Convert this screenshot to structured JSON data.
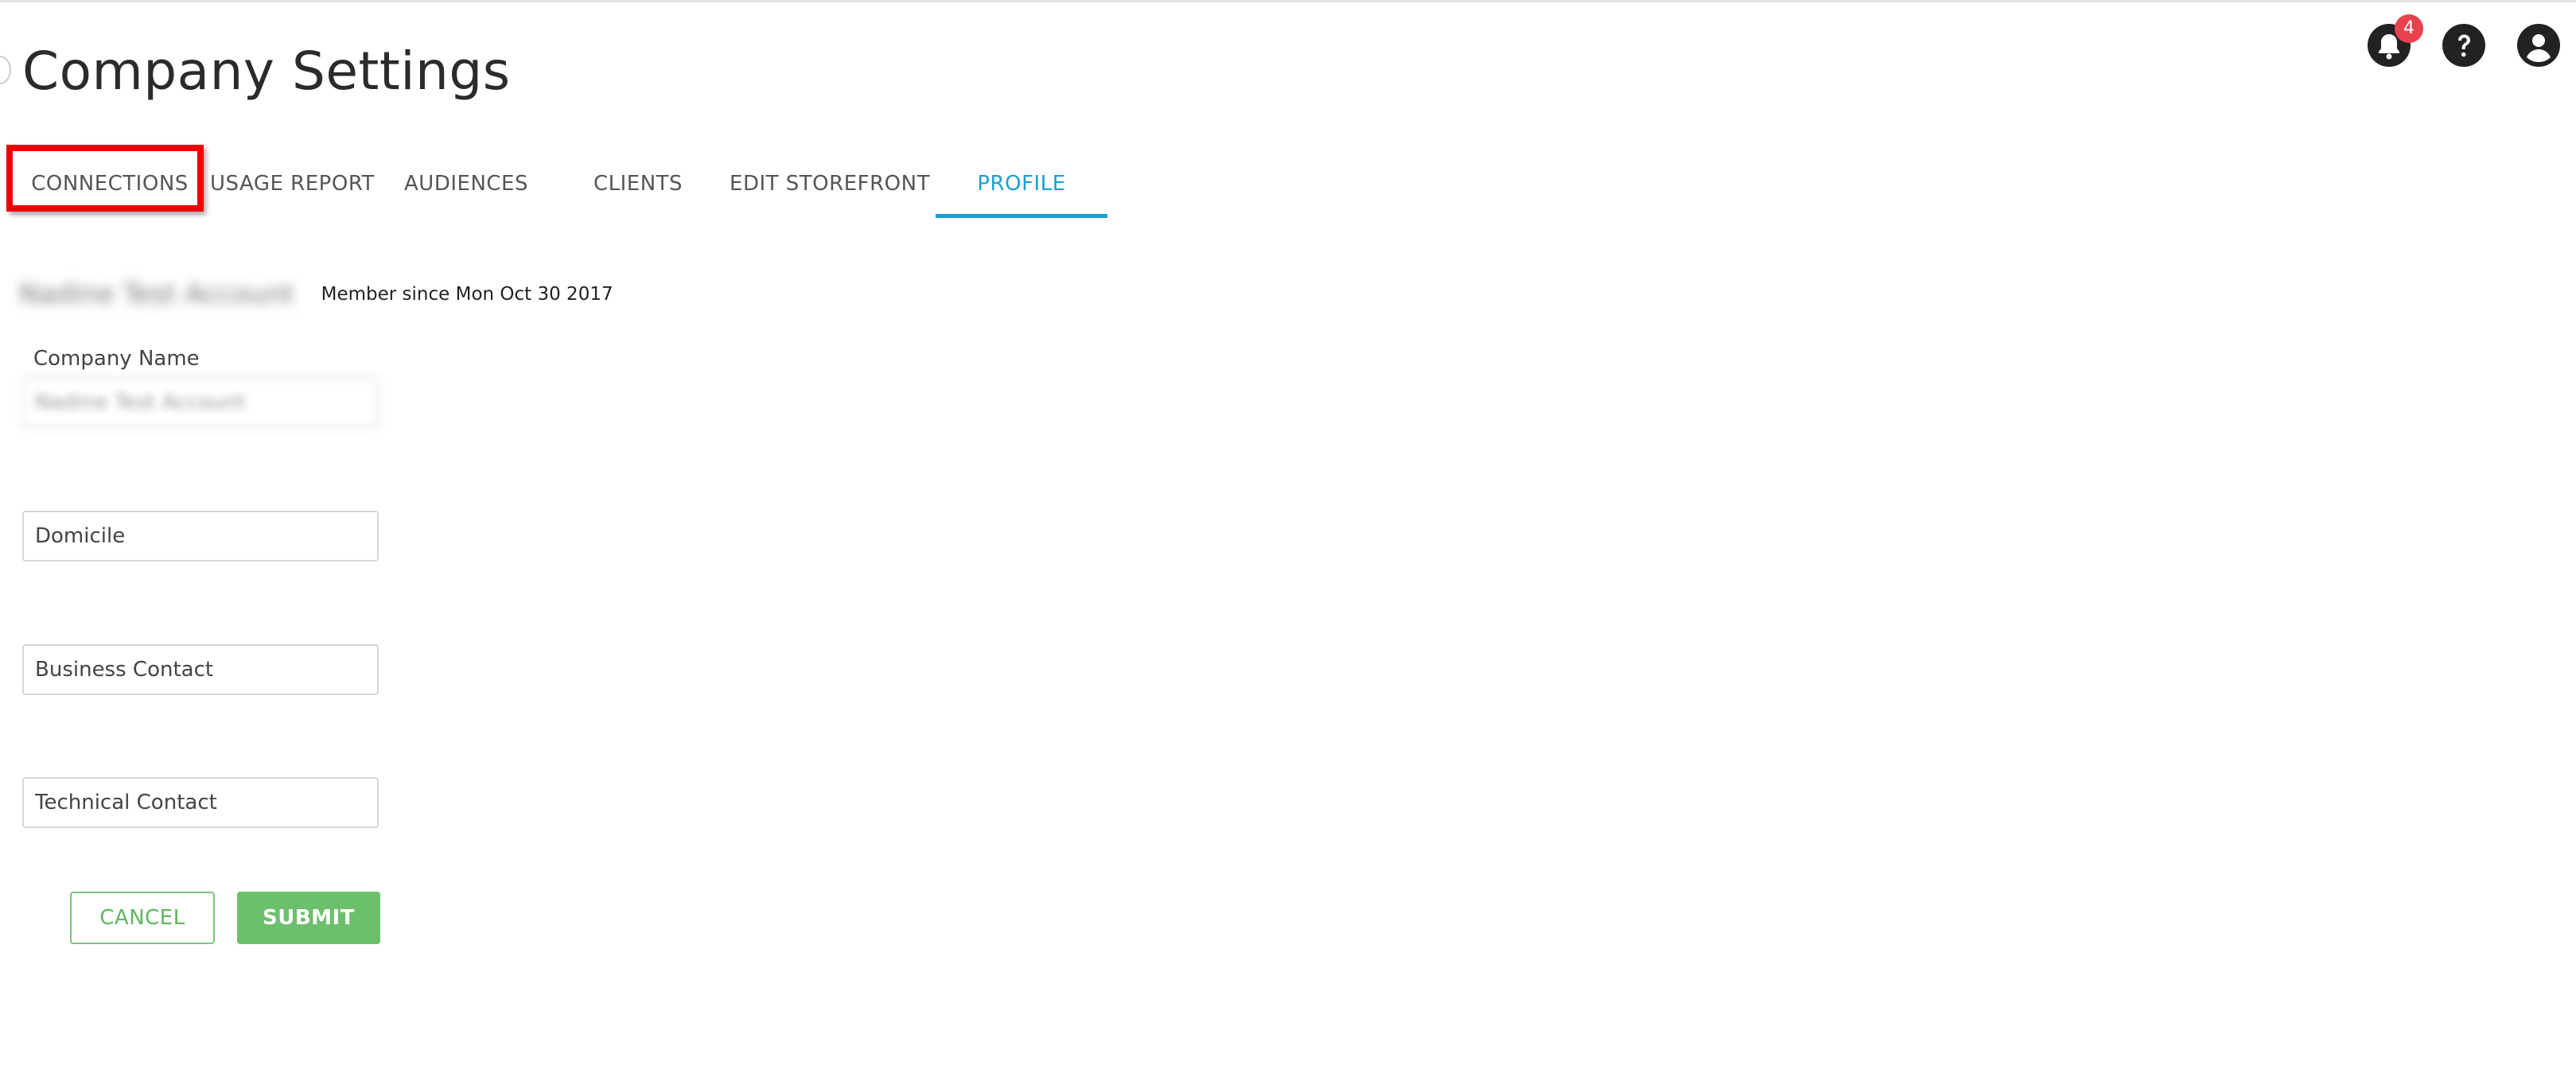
{
  "header": {
    "title": "Company Settings",
    "notifications_count": "4",
    "icons": [
      "bell-icon",
      "help-icon",
      "account-icon"
    ]
  },
  "tabs": [
    {
      "label": "CONNECTIONS",
      "active": false
    },
    {
      "label": "USAGE REPORT",
      "active": false
    },
    {
      "label": "AUDIENCES",
      "active": false
    },
    {
      "label": "CLIENTS",
      "active": false
    },
    {
      "label": "EDIT STOREFRONT",
      "active": false
    },
    {
      "label": "PROFILE",
      "active": true
    }
  ],
  "profile": {
    "account_name": "Nadine Test Account",
    "member_since": "Member since Mon Oct 30 2017",
    "company_name_label": "Company Name",
    "company_name_value": "Nadine Test Account",
    "domicile_placeholder": "Domicile",
    "business_contact_placeholder": "Business Contact",
    "technical_contact_placeholder": "Technical Contact"
  },
  "actions": {
    "cancel_label": "CANCEL",
    "submit_label": "SUBMIT"
  },
  "colors": {
    "accent": "#1a9fd1",
    "success": "#6cc06c",
    "badge": "#e8424e",
    "highlight": "#ee0000"
  }
}
